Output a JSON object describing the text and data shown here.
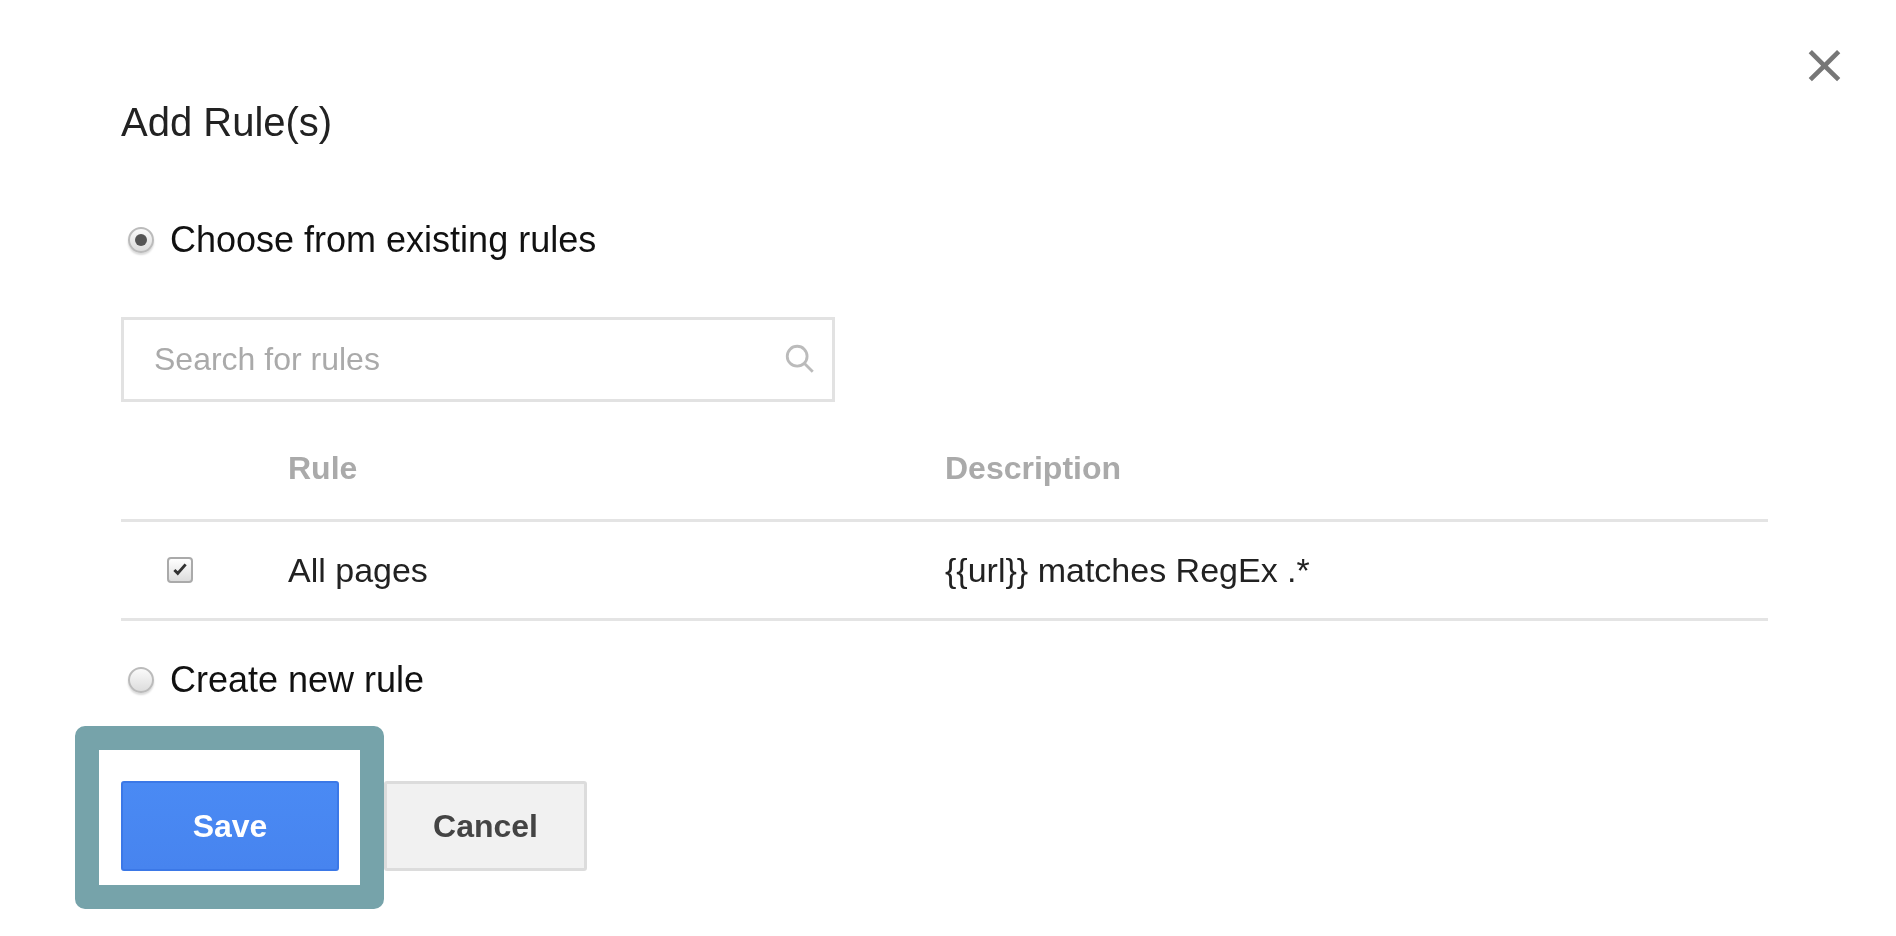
{
  "dialog": {
    "title": "Add Rule(s)",
    "close": "×"
  },
  "options": [
    {
      "label": "Choose from existing rules",
      "selected": true
    },
    {
      "label": "Create new rule",
      "selected": false
    }
  ],
  "search": {
    "placeholder": "Search for rules"
  },
  "table": {
    "columns": [
      "Rule",
      "Description"
    ],
    "rows": [
      {
        "checked": true,
        "rule": "All pages",
        "description": "{{url}} matches RegEx .*"
      }
    ]
  },
  "buttons": [
    {
      "label": "Save",
      "kind": "primary",
      "highlighted": true
    },
    {
      "label": "Cancel",
      "kind": "secondary",
      "highlighted": false
    }
  ]
}
